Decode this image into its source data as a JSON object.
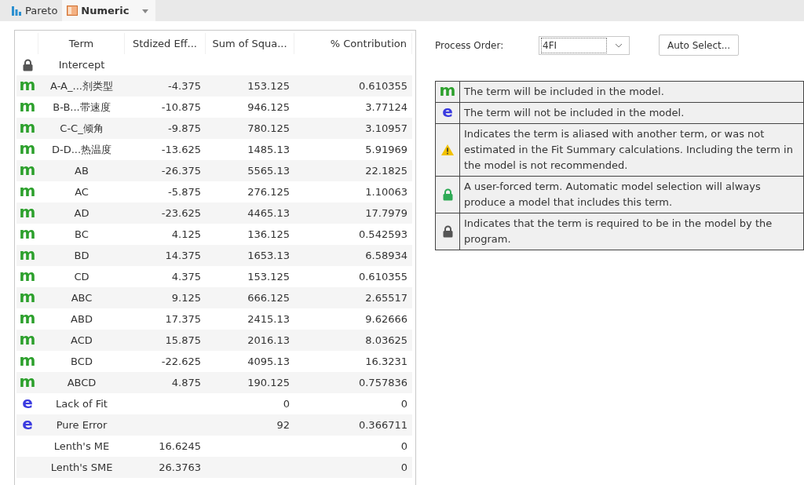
{
  "tabs": [
    {
      "label": "Pareto",
      "kind": "chart",
      "selected": false
    },
    {
      "label": "Numeric",
      "kind": "sheet",
      "selected": true
    }
  ],
  "table": {
    "columns": [
      "Term",
      "Stdized Eff...",
      "Sum of Squa...",
      "% Contribution"
    ],
    "rows": [
      {
        "marker": {
          "kind": "required"
        },
        "cells": [
          "Intercept",
          "",
          "",
          ""
        ]
      },
      {
        "marker": {
          "kind": "model",
          "symbol": "m"
        },
        "cells": [
          "A-A_...剂类型",
          "-4.375",
          "153.125",
          "0.610355"
        ]
      },
      {
        "marker": {
          "kind": "model",
          "symbol": "m"
        },
        "cells": [
          "B-B...带速度",
          "-10.875",
          "946.125",
          "3.77124"
        ]
      },
      {
        "marker": {
          "kind": "model",
          "symbol": "m"
        },
        "cells": [
          "C-C_倾角",
          "-9.875",
          "780.125",
          "3.10957"
        ]
      },
      {
        "marker": {
          "kind": "model",
          "symbol": "m"
        },
        "cells": [
          "D-D...热温度",
          "-13.625",
          "1485.13",
          "5.91969"
        ]
      },
      {
        "marker": {
          "kind": "model",
          "symbol": "m"
        },
        "cells": [
          "AB",
          "-26.375",
          "5565.13",
          "22.1825"
        ]
      },
      {
        "marker": {
          "kind": "model",
          "symbol": "m"
        },
        "cells": [
          "AC",
          "-5.875",
          "276.125",
          "1.10063"
        ]
      },
      {
        "marker": {
          "kind": "model",
          "symbol": "m"
        },
        "cells": [
          "AD",
          "-23.625",
          "4465.13",
          "17.7979"
        ]
      },
      {
        "marker": {
          "kind": "model",
          "symbol": "m"
        },
        "cells": [
          "BC",
          "4.125",
          "136.125",
          "0.542593"
        ]
      },
      {
        "marker": {
          "kind": "model",
          "symbol": "m"
        },
        "cells": [
          "BD",
          "14.375",
          "1653.13",
          "6.58934"
        ]
      },
      {
        "marker": {
          "kind": "model",
          "symbol": "m"
        },
        "cells": [
          "CD",
          "4.375",
          "153.125",
          "0.610355"
        ]
      },
      {
        "marker": {
          "kind": "model",
          "symbol": "m"
        },
        "cells": [
          "ABC",
          "9.125",
          "666.125",
          "2.65517"
        ]
      },
      {
        "marker": {
          "kind": "model",
          "symbol": "m"
        },
        "cells": [
          "ABD",
          "17.375",
          "2415.13",
          "9.62666"
        ]
      },
      {
        "marker": {
          "kind": "model",
          "symbol": "m"
        },
        "cells": [
          "ACD",
          "15.875",
          "2016.13",
          "8.03625"
        ]
      },
      {
        "marker": {
          "kind": "model",
          "symbol": "m"
        },
        "cells": [
          "BCD",
          "-22.625",
          "4095.13",
          "16.3231"
        ]
      },
      {
        "marker": {
          "kind": "model",
          "symbol": "m"
        },
        "cells": [
          "ABCD",
          "4.875",
          "190.125",
          "0.757836"
        ]
      },
      {
        "marker": {
          "kind": "error",
          "symbol": "e"
        },
        "cells": [
          "Lack of Fit",
          "",
          "0",
          "0"
        ]
      },
      {
        "marker": {
          "kind": "error",
          "symbol": "e"
        },
        "cells": [
          "Pure Error",
          "",
          "92",
          "0.366711"
        ]
      },
      {
        "marker": {
          "kind": "none"
        },
        "cells": [
          "Lenth's ME",
          "16.6245",
          "",
          "0"
        ]
      },
      {
        "marker": {
          "kind": "none"
        },
        "cells": [
          "Lenth's SME",
          "26.3763",
          "",
          "0"
        ]
      }
    ]
  },
  "process_order": {
    "label": "Process Order:",
    "value": "4FI"
  },
  "auto_select_button": "Auto Select...",
  "legend": [
    {
      "kind": "model",
      "symbol": "m",
      "text": "The term will be included in the model."
    },
    {
      "kind": "error",
      "symbol": "e",
      "text": "The term will not be included in the model."
    },
    {
      "kind": "warning",
      "text": "Indicates the term is aliased with another term, or was not estimated in the Fit Summary calculations. Including the term in the model is not recommended."
    },
    {
      "kind": "forced",
      "text": "A user-forced term. Automatic model selection will always produce a model that includes this term."
    },
    {
      "kind": "required",
      "text": "Indicates that the term is required to be in the model by the program."
    }
  ]
}
